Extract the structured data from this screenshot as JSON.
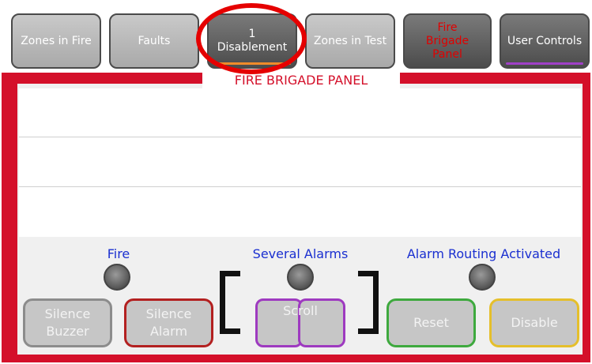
{
  "tabs": [
    {
      "label": "Zones in Fire"
    },
    {
      "label": "Faults"
    },
    {
      "label_line1": "1",
      "label_line2": "Disablement"
    },
    {
      "label": "Zones in Test"
    },
    {
      "label_line1": "Fire",
      "label_line2": "Brigade",
      "label_line3": "Panel"
    },
    {
      "label": "User Controls"
    }
  ],
  "panel": {
    "title": "FIRE BRIGADE PANEL"
  },
  "status": {
    "fire": "Fire",
    "several_alarms": "Several Alarms",
    "alarm_routing": "Alarm Routing Activated"
  },
  "buttons": {
    "silence_buzzer_1": "Silence",
    "silence_buzzer_2": "Buzzer",
    "silence_alarm_1": "Silence",
    "silence_alarm_2": "Alarm",
    "scroll": "Scroll",
    "reset": "Reset",
    "disable": "Disable"
  },
  "colors": {
    "frame_red": "#d4102a",
    "status_text_blue": "#1a2fd0",
    "annotation_red": "#e50000"
  }
}
